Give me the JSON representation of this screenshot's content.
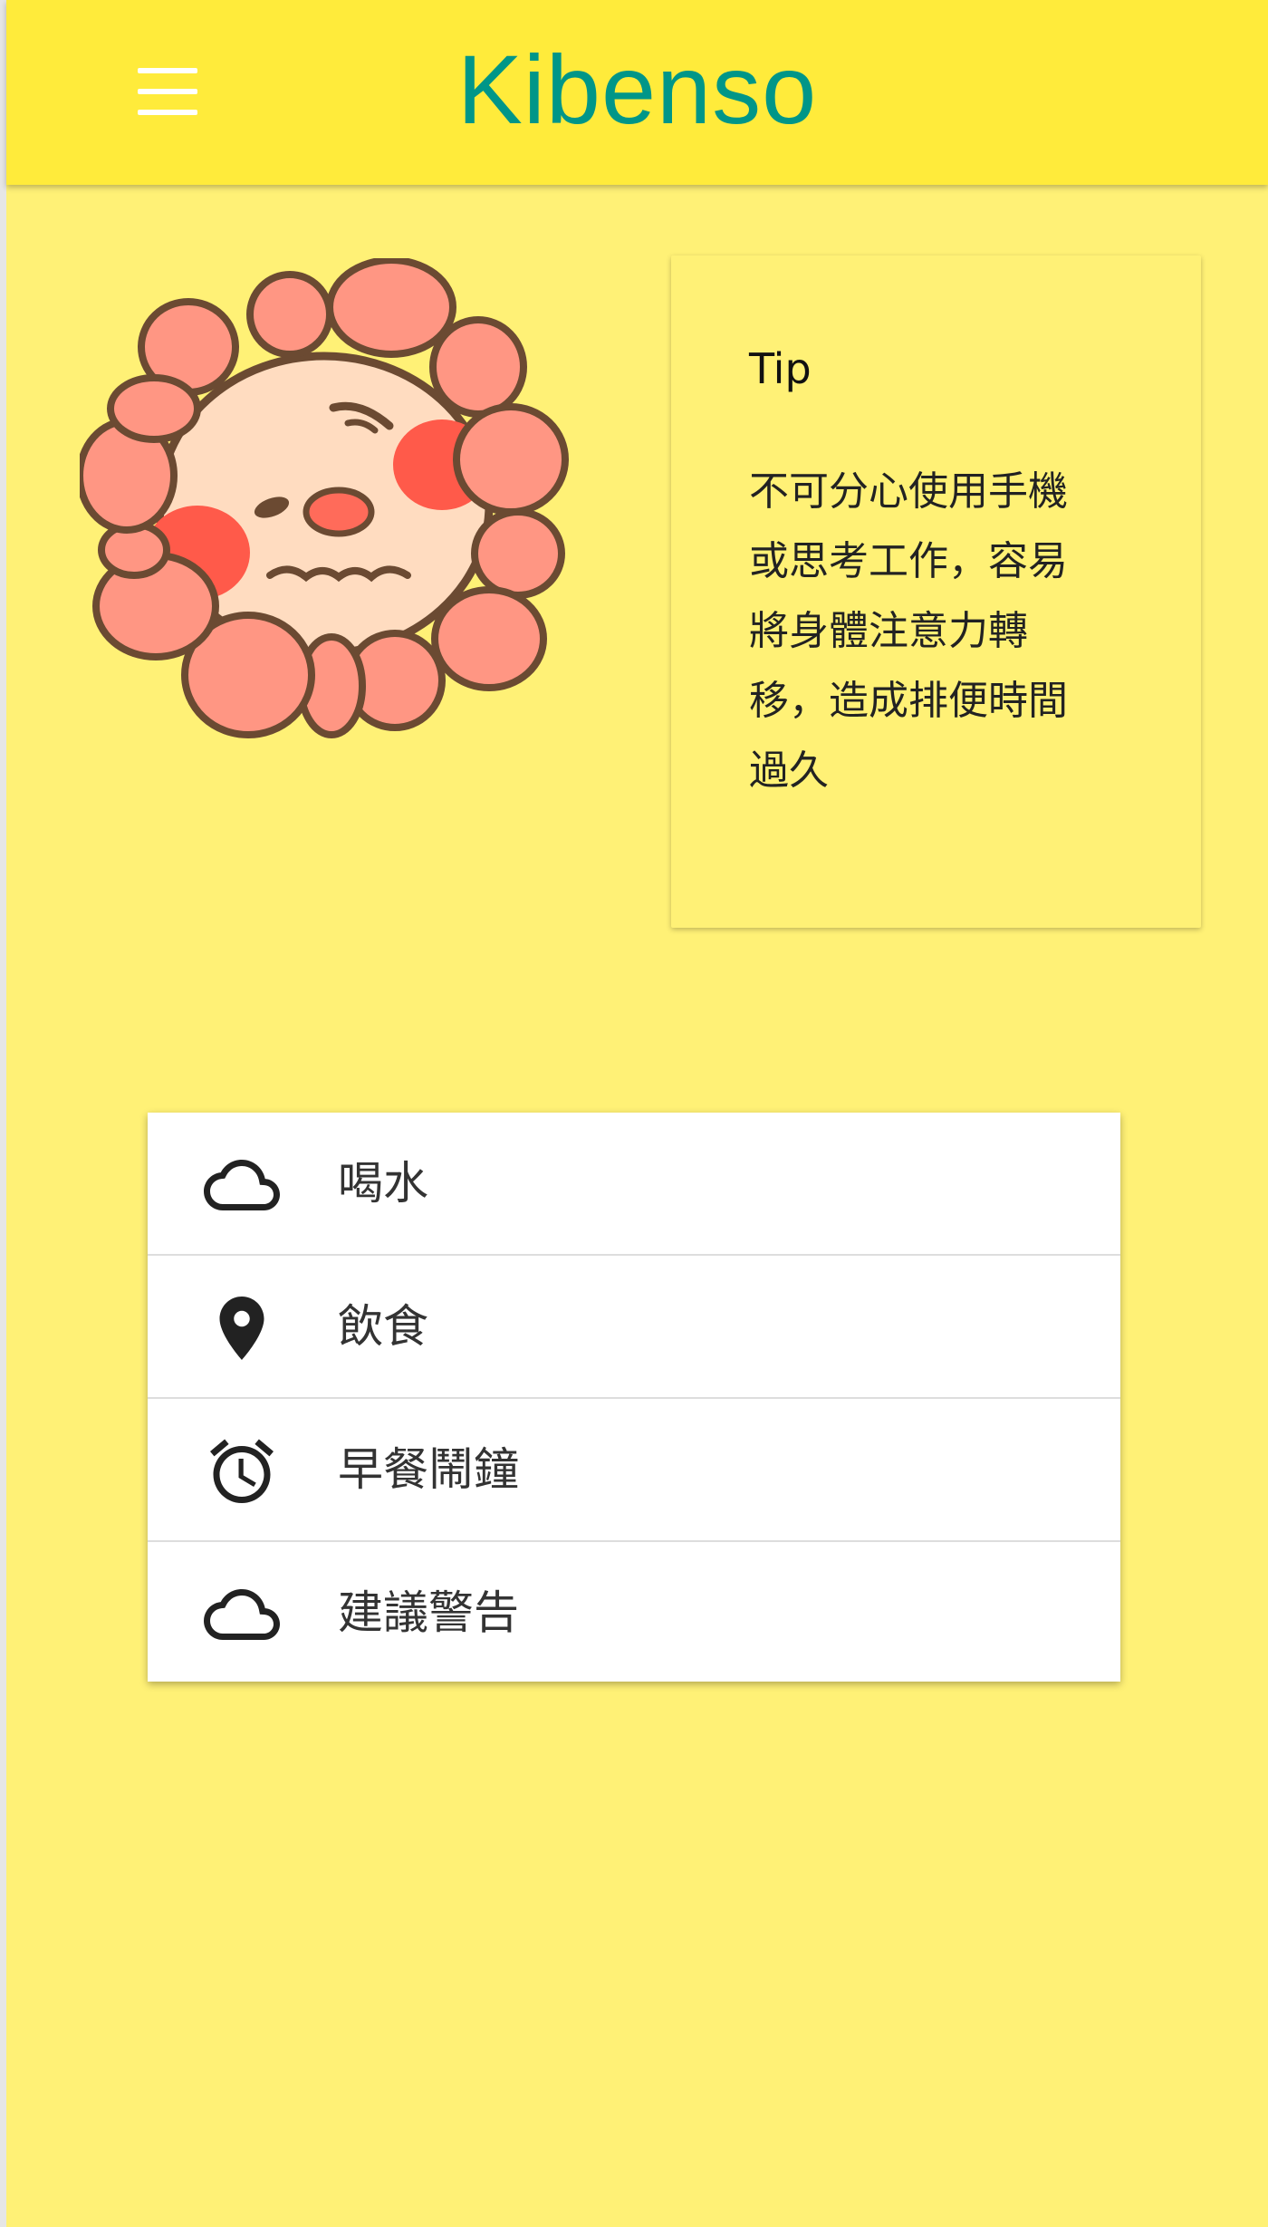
{
  "app": {
    "title": "Kibenso"
  },
  "appbar": {
    "menu_icon": "menu-icon",
    "background": "#ffeb3b",
    "title_color": "#009688"
  },
  "page": {
    "background": "#fff176"
  },
  "tip": {
    "title": "Tip",
    "body": "不可分心使用手機或思考工作，容易將身體注意力轉移，造成排便時間過久"
  },
  "menu": {
    "items": [
      {
        "label": "喝水",
        "icon": "cloud-icon"
      },
      {
        "label": "飲食",
        "icon": "location-pin-icon"
      },
      {
        "label": "早餐鬧鐘",
        "icon": "alarm-clock-icon"
      },
      {
        "label": "建議警告",
        "icon": "cloud-icon"
      }
    ]
  }
}
